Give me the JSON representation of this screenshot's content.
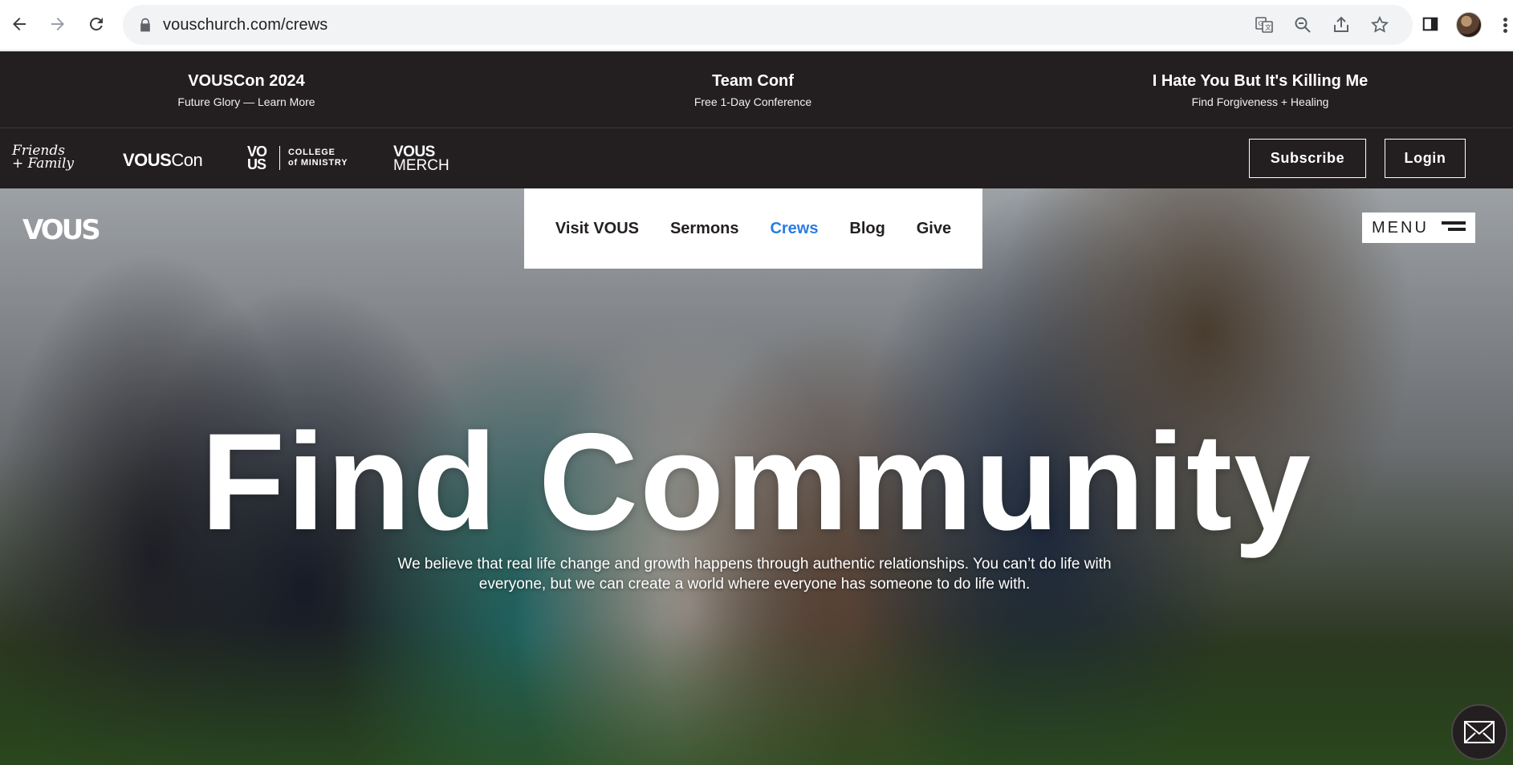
{
  "browser": {
    "url": "vouschurch.com/crews",
    "icons": [
      "back-icon",
      "forward-icon",
      "reload-icon",
      "lock-icon",
      "translate-icon",
      "zoom-out-icon",
      "share-icon",
      "bookmark-star-icon",
      "side-panel-icon",
      "profile-avatar",
      "more-menu-icon"
    ]
  },
  "announcements": [
    {
      "title": "VOUSCon 2024",
      "subtitle": "Future Glory — Learn More"
    },
    {
      "title": "Team Conf",
      "subtitle": "Free 1-Day Conference"
    },
    {
      "title": "I Hate You But It's Killing Me",
      "subtitle": "Find Forgiveness + Healing"
    }
  ],
  "subnav": {
    "friends_family_line1": "Friends",
    "friends_family_line2": "+ Family",
    "vouscon_bold": "VOUS",
    "vouscon_light": "Con",
    "college_vous_line1": "VO",
    "college_vous_line2": "US",
    "college_line1": "COLLEGE",
    "college_line2": "of MINISTRY",
    "merch_line1": "VOUS",
    "merch_line2": "MERCH",
    "subscribe_label": "Subscribe",
    "login_label": "Login"
  },
  "hero": {
    "logo": "VOUS",
    "nav": [
      {
        "label": "Visit VOUS",
        "active": false
      },
      {
        "label": "Sermons",
        "active": false
      },
      {
        "label": "Crews",
        "active": true
      },
      {
        "label": "Blog",
        "active": false
      },
      {
        "label": "Give",
        "active": false
      }
    ],
    "menu_label": "MENU",
    "title": "Find Community",
    "subtitle_line1": "We believe that real life change and growth happens through authentic relationships. You can’t do life with",
    "subtitle_line2": "everyone, but we can create a world where everyone has someone to do life with."
  },
  "colors": {
    "dark_bar": "#231f20",
    "active_link": "#2a7de1"
  }
}
